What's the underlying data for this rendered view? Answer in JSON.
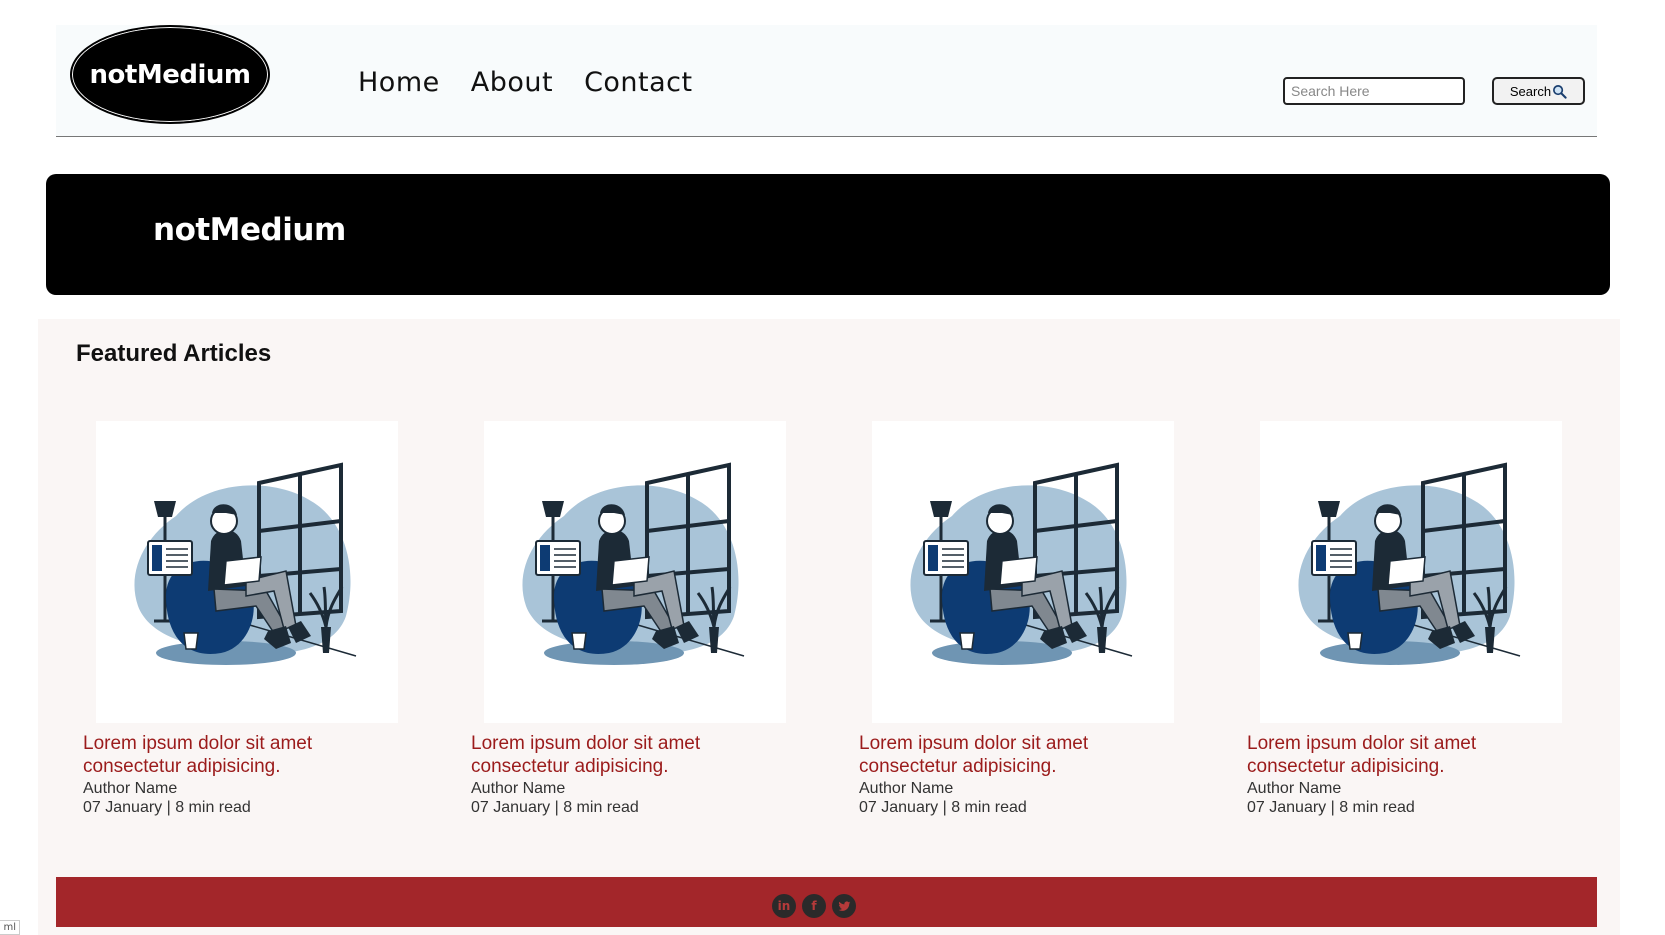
{
  "navbar": {
    "logo_text": "notMedium",
    "links": [
      "Home",
      "About",
      "Contact"
    ],
    "search_placeholder": "Search Here",
    "search_button": "Search"
  },
  "hero": {
    "title": "notMedium"
  },
  "featured": {
    "heading": "Featured Articles",
    "articles": [
      {
        "title": "Lorem ipsum dolor sit amet consectetur adipisicing.",
        "author": "Author Name",
        "meta": "07 January | 8 min read"
      },
      {
        "title": "Lorem ipsum dolor sit amet consectetur adipisicing.",
        "author": "Author Name",
        "meta": "07 January | 8 min read"
      },
      {
        "title": "Lorem ipsum dolor sit amet consectetur adipisicing.",
        "author": "Author Name",
        "meta": "07 January | 8 min read"
      },
      {
        "title": "Lorem ipsum dolor sit amet consectetur adipisicing.",
        "author": "Author Name",
        "meta": "07 January | 8 min read"
      }
    ]
  },
  "footer": {
    "socials": [
      {
        "icon": "linkedin-icon",
        "glyph": "in"
      },
      {
        "icon": "facebook-icon",
        "glyph": "f"
      },
      {
        "icon": "twitter-icon",
        "glyph": "t"
      }
    ]
  },
  "corner_tag": "ml",
  "colors": {
    "article_title": "#9b1b1b",
    "footer_bg": "#a3262a",
    "hero_bg": "#000000",
    "illustration_blue": "#0d3b73",
    "illustration_light": "#a9c4d8"
  }
}
